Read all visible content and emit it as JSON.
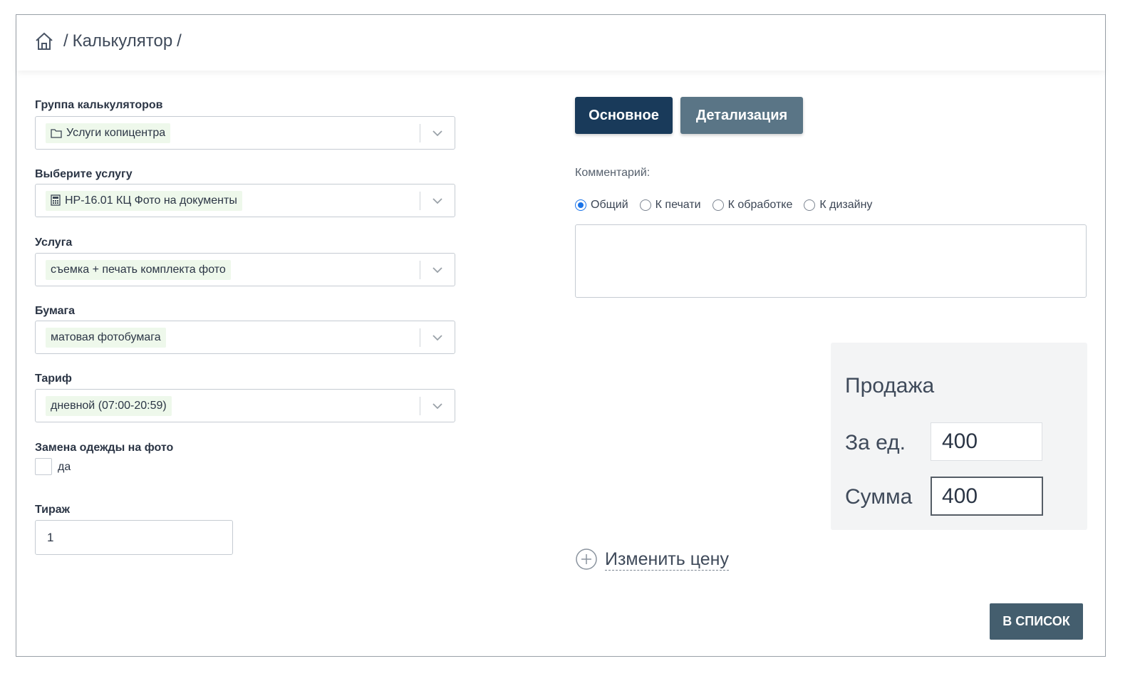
{
  "breadcrumb": {
    "home_icon": "home-icon",
    "separator": "/",
    "current": "Калькулятор",
    "trailing": "/"
  },
  "form": {
    "calc_group": {
      "label": "Группа калькуляторов",
      "value": "Услуги копицентра",
      "icon": "folder-icon"
    },
    "service_select": {
      "label": "Выберите услугу",
      "value": "НР-16.01 КЦ Фото на документы",
      "icon": "calculator-icon"
    },
    "service": {
      "label": "Услуга",
      "value": "съемка + печать комплекта фото"
    },
    "paper": {
      "label": "Бумага",
      "value": "матовая фотобумага"
    },
    "tariff": {
      "label": "Тариф",
      "value": "дневной (07:00-20:59)"
    },
    "clothes_change": {
      "label": "Замена одежды на фото",
      "option": "да",
      "checked": false
    },
    "quantity": {
      "label": "Тираж",
      "value": "1"
    }
  },
  "tabs": {
    "main": "Основное",
    "details": "Детализация",
    "active": "main"
  },
  "comment": {
    "label": "Комментарий:",
    "options": [
      "Общий",
      "К печати",
      "К обработке",
      "К дизайну"
    ],
    "selected": "Общий",
    "text": ""
  },
  "sale": {
    "title": "Продажа",
    "unit_label": "За ед.",
    "unit_value": "400",
    "sum_label": "Сумма",
    "sum_value": "400"
  },
  "change_price": {
    "label": "Изменить цену",
    "icon": "plus-circle-icon"
  },
  "to_list_button": "В СПИСОК",
  "colors": {
    "primary": "#193a5a",
    "secondary": "#5a7586",
    "list_button": "#445e6e",
    "chip_bg": "#eef8eb",
    "radio_accent": "#1a73e8"
  }
}
